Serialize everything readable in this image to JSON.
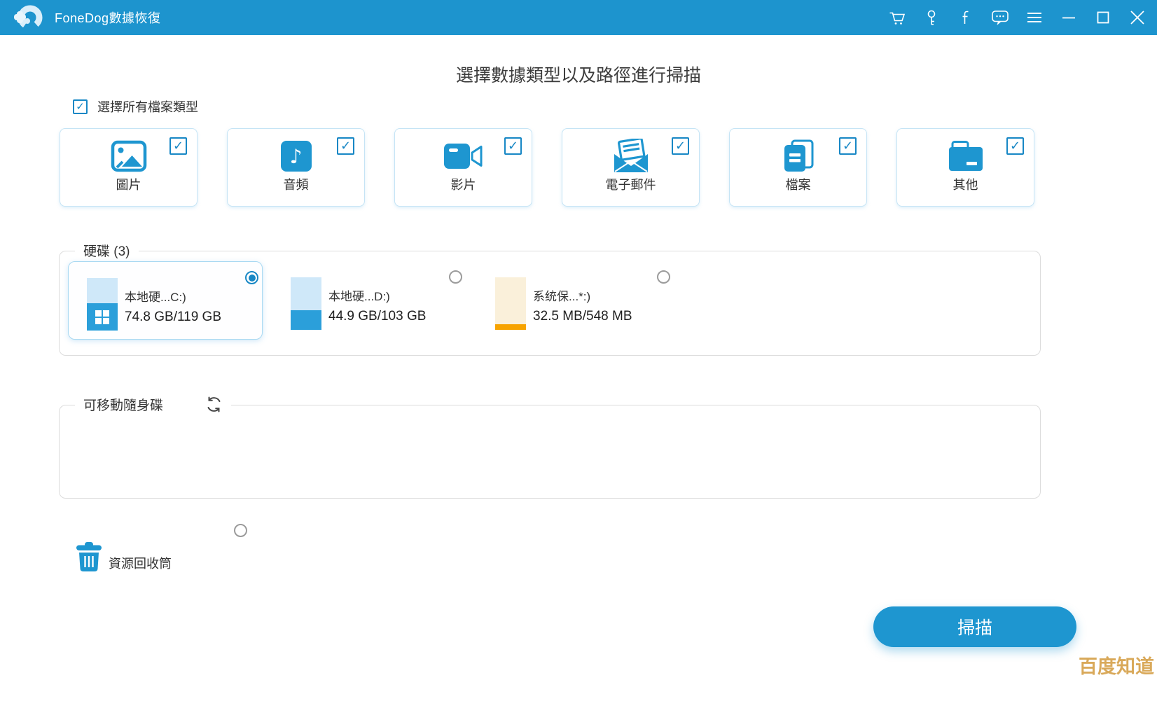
{
  "titlebar": {
    "title": "FoneDog數據恢復",
    "icons": [
      "cart-icon",
      "key-icon",
      "facebook-icon",
      "chat-icon",
      "menu-icon",
      "minimize-icon",
      "maximize-icon",
      "close-icon"
    ]
  },
  "header": {
    "title": "選擇數據類型以及路徑進行掃描"
  },
  "select_all_label": "選擇所有檔案類型",
  "file_types": [
    {
      "label": "圖片",
      "icon": "image-icon",
      "checked": true
    },
    {
      "label": "音頻",
      "icon": "audio-icon",
      "checked": true
    },
    {
      "label": "影片",
      "icon": "video-icon",
      "checked": true
    },
    {
      "label": "電子郵件",
      "icon": "email-icon",
      "checked": true
    },
    {
      "label": "檔案",
      "icon": "document-icon",
      "checked": true
    },
    {
      "label": "其他",
      "icon": "folder-icon",
      "checked": true
    }
  ],
  "drives": {
    "legend": "硬碟 (3)",
    "items": [
      {
        "name": "本地硬...C:)",
        "capacity": "74.8 GB/119 GB",
        "selected": true,
        "used_percent": 52,
        "style": "windows-blue"
      },
      {
        "name": "本地硬...D:)",
        "capacity": "44.9 GB/103 GB",
        "selected": false,
        "used_percent": 38,
        "style": "blue"
      },
      {
        "name": "系统保...*:)",
        "capacity": "32.5 MB/548 MB",
        "selected": false,
        "used_percent": 6,
        "style": "system-orange"
      }
    ]
  },
  "removable": {
    "legend": "可移動隨身碟"
  },
  "recycle_bin_label": "資源回收筒",
  "scan_button_label": "掃描",
  "watermark": "百度知道",
  "glyphs": {
    "check": "✓",
    "music_note": "♪"
  },
  "colors": {
    "titlebar": "#1d94ce",
    "accent": "#1e96d0",
    "system_orange": "#f7a300",
    "beige": "#faf0da",
    "light_blue": "#cfe8f9",
    "watermark": "#d9a95a"
  }
}
